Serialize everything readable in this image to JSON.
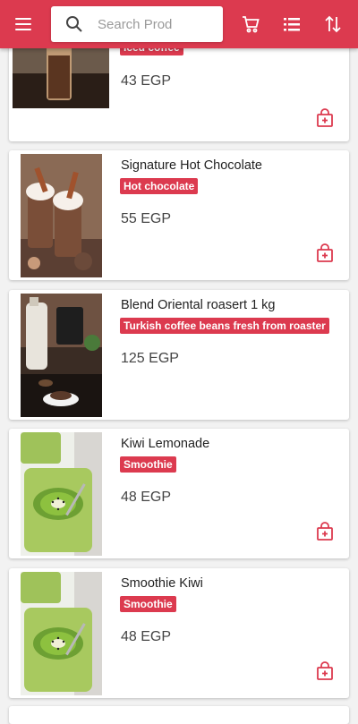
{
  "colors": {
    "accent": "#dc3a4f",
    "background": "#f2f2f2",
    "card": "#ffffff"
  },
  "appbar": {
    "menu_icon": "menu-icon",
    "search": {
      "placeholder": "Search Products",
      "icon": "search-icon"
    },
    "cart_icon": "shopping-cart-icon",
    "list_icon": "list-view-icon",
    "sort_icon": "sort-icon"
  },
  "products": [
    {
      "name": "",
      "tag": "Iced coffee",
      "price": "43 EGP",
      "image": "iced-coffee-photo"
    },
    {
      "name": "Signature Hot Chocolate",
      "tag": "Hot chocolate",
      "price": "55 EGP",
      "image": "hot-chocolate-photo"
    },
    {
      "name": "Blend Oriental roasert 1 kg",
      "tag": "Turkish coffee beans fresh from roaster",
      "price": "125 EGP",
      "image": "coffee-beans-photo"
    },
    {
      "name": "Kiwi Lemonade",
      "tag": "Smoothie",
      "price": "48 EGP",
      "image": "kiwi-smoothie-photo"
    },
    {
      "name": "Smoothie Kiwi",
      "tag": "Smoothie",
      "price": "48 EGP",
      "image": "kiwi-smoothie-photo"
    }
  ]
}
